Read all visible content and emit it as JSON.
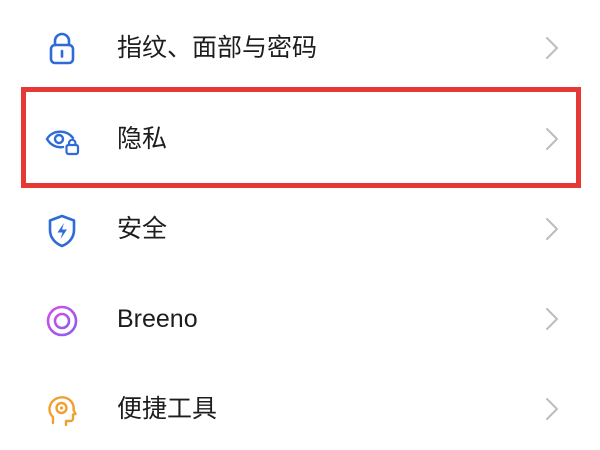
{
  "settings": {
    "items": [
      {
        "label": "指纹、面部与密码",
        "icon": "lock-icon",
        "icon_color": "#2f6bd8"
      },
      {
        "label": "隐私",
        "icon": "privacy-eye-lock-icon",
        "icon_color": "#2f6bd8"
      },
      {
        "label": "安全",
        "icon": "security-shield-icon",
        "icon_color": "#2f6bd8"
      },
      {
        "label": "Breeno",
        "icon": "breeno-icon",
        "icon_color": "#b15fe0"
      },
      {
        "label": "便捷工具",
        "icon": "convenience-tools-icon",
        "icon_color": "#f0a030"
      }
    ]
  },
  "highlight": {
    "target": "privacy",
    "color": "#e53935"
  },
  "chevron_color": "#bdbdbd"
}
